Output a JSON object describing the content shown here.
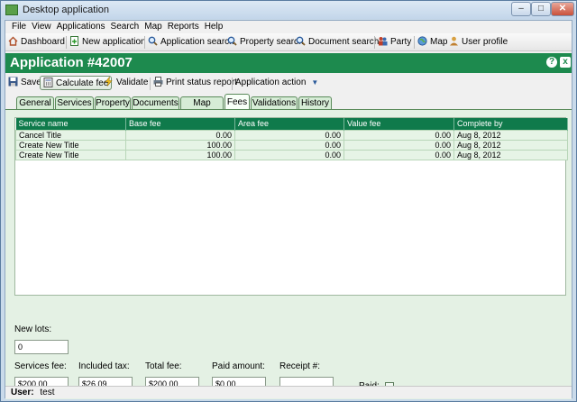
{
  "window": {
    "title": "Desktop application"
  },
  "menu": [
    "File",
    "View",
    "Applications",
    "Search",
    "Map",
    "Reports",
    "Help"
  ],
  "toolbar": {
    "dashboard": "Dashboard",
    "new_application": "New application",
    "application_search": "Application search",
    "property_search": "Property search",
    "document_search": "Document search",
    "party": "Party",
    "map": "Map",
    "user_profile": "User profile"
  },
  "header": {
    "title": "Application #42007",
    "help": "?",
    "close": "x"
  },
  "actions": {
    "save": "Save",
    "calculate_fee": "Calculate fee",
    "validate": "Validate",
    "print_status_report": "Print status report",
    "application_action": "Application action"
  },
  "tabs": [
    "General",
    "Services",
    "Property",
    "Documents",
    "Map points",
    "Fees",
    "Validations",
    "History"
  ],
  "active_tab": "Fees",
  "fees_table": {
    "columns": [
      "Service name",
      "Base fee",
      "Area fee",
      "Value fee",
      "Complete by"
    ],
    "rows": [
      [
        "Cancel Title",
        "0.00",
        "0.00",
        "0.00",
        "Aug 8, 2012"
      ],
      [
        "Create New Title",
        "100.00",
        "0.00",
        "0.00",
        "Aug 8, 2012"
      ],
      [
        "Create New Title",
        "100.00",
        "0.00",
        "0.00",
        "Aug 8, 2012"
      ]
    ]
  },
  "form": {
    "new_lots_label": "New lots:",
    "new_lots_value": "0",
    "services_fee_label": "Services fee:",
    "services_fee_value": "$200.00",
    "included_tax_label": "Included tax:",
    "included_tax_value": "$26.09",
    "total_fee_label": "Total fee:",
    "total_fee_value": "$200.00",
    "paid_amount_label": "Paid amount:",
    "paid_amount_value": "$0.00",
    "receipt_label": "Receipt #:",
    "receipt_value": "",
    "paid_label": "Paid:"
  },
  "status": {
    "user_label": "User:",
    "user_value": "test"
  },
  "colors": {
    "accent": "#1d8a4e",
    "grid_header": "#0f7a4b",
    "panel": "#e4f1e4"
  }
}
